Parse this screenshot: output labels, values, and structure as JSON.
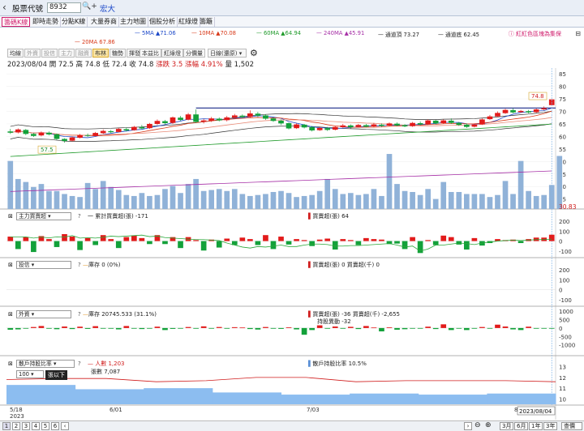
{
  "header": {
    "back_icon": "chevron-left",
    "label": "股票代號",
    "code": "8932",
    "stock_name": "宏大"
  },
  "tabs": [
    "籌碼K線",
    "即時走勢",
    "分點K線",
    "大量券商",
    "主力地圖",
    "個股分析",
    "紅綠燈",
    "籌籬"
  ],
  "ma_legend": [
    {
      "label": "5MA ▲71.06",
      "color": "#1a47c8"
    },
    {
      "label": "10MA ▲70.08",
      "color": "#d83a1a"
    },
    {
      "label": "60MA ▲64.94",
      "color": "#1f9a2a"
    },
    {
      "label": "240MA ▲45.91",
      "color": "#a62fa6"
    },
    {
      "label": "通道頂 73.27",
      "color": "#333333"
    },
    {
      "label": "通道底 62.45",
      "color": "#333333"
    }
  ],
  "ma20_label": "20MA 67.86",
  "promo_text": "紅紅色區塊為集保",
  "toolbar": [
    "均線",
    "外資",
    "投信",
    "主力",
    "融資",
    "布林",
    "糖勢",
    "揮發",
    "本益比",
    "紅綠燈",
    "分價量"
  ],
  "toolbar_selected": "布林",
  "period_select": "日線(還原)",
  "quote": {
    "date": "2023/08/04",
    "open": "開 72.5",
    "high": "高 74.8",
    "low": "低 72.4",
    "close": "收 74.8",
    "change": "漲跌 3.5",
    "pct": "漲幅 4.91%",
    "vol": "量 1,502"
  },
  "price_labels": {
    "high": "74.8",
    "low": "57.5",
    "ma_tag": "30.83"
  },
  "price_axis": [
    "85",
    "80",
    "75",
    "70",
    "65",
    "60",
    "55",
    "50",
    "45",
    "40",
    "35"
  ],
  "panels": [
    {
      "select": "主力買賣超",
      "legend_line": "一 累計買賣超(張) -171",
      "legend_bar": "買賣超(張) 64",
      "axis": [
        "200",
        "100",
        "0",
        "-100"
      ]
    },
    {
      "select": "投信",
      "legend_line": "庫存 0 (0%)",
      "legend_bar": "買賣超(張) 0 買賣超(千) 0",
      "axis": [
        "200",
        "100",
        "0",
        "-100"
      ]
    },
    {
      "select": "外資",
      "legend_line": "庫存 20745.533 (31.1%)",
      "legend_bar": "買賣超(張) -36 買賣超(千) -2,655",
      "legend_extra": "持股異動 -32",
      "axis": [
        "1000",
        "500",
        "0",
        "-500",
        "-1000"
      ]
    },
    {
      "select": "散戶持股比率",
      "legend_line": "人數 1,203",
      "legend_line2": "張數 7,087",
      "legend_bar": "散戶持股比率 10.5%",
      "input_value": "100",
      "input_suffix": "張以下",
      "axis": [
        "13",
        "12",
        "11",
        "10"
      ]
    }
  ],
  "x_axis": {
    "labels": [
      "5/18\n2023",
      "6/01",
      "7/03",
      "8"
    ],
    "current": "2023/08/04"
  },
  "bottom_bar": {
    "pages": [
      "1",
      "2",
      "3",
      "4",
      "5",
      "6"
    ],
    "ranges": [
      "3月",
      "6月",
      "1年",
      "3年",
      "查價"
    ]
  },
  "chart_data": [
    {
      "type": "candlestick",
      "title": "",
      "period": "日線(還原)",
      "candles": [
        [
          62.0,
          61.5,
          63.0,
          61.0
        ],
        [
          61.6,
          62.8,
          63.2,
          61.2
        ],
        [
          62.6,
          61.0,
          63.0,
          60.5
        ],
        [
          61.0,
          60.2,
          61.4,
          59.8
        ],
        [
          60.4,
          61.6,
          62.0,
          60.0
        ],
        [
          61.5,
          60.8,
          62.0,
          60.4
        ],
        [
          60.9,
          59.0,
          61.2,
          58.6
        ],
        [
          59.0,
          58.2,
          59.3,
          57.5
        ],
        [
          58.3,
          59.6,
          60.0,
          58.0
        ],
        [
          59.5,
          60.5,
          61.0,
          59.2
        ],
        [
          60.5,
          60.2,
          61.2,
          59.8
        ],
        [
          60.2,
          61.4,
          61.8,
          60.0
        ],
        [
          61.3,
          62.2,
          62.8,
          61.0
        ],
        [
          62.1,
          61.7,
          62.6,
          61.3
        ],
        [
          61.8,
          63.0,
          63.4,
          61.6
        ],
        [
          62.9,
          62.4,
          63.6,
          62.0
        ],
        [
          62.5,
          63.8,
          64.2,
          62.3
        ],
        [
          63.7,
          63.2,
          64.6,
          62.8
        ],
        [
          63.3,
          65.0,
          65.4,
          63.0
        ],
        [
          65.0,
          66.2,
          66.8,
          64.6
        ],
        [
          66.1,
          65.3,
          66.6,
          64.8
        ],
        [
          65.4,
          67.6,
          68.0,
          65.0
        ],
        [
          67.5,
          66.6,
          68.2,
          66.2
        ],
        [
          66.7,
          68.8,
          69.4,
          66.4
        ],
        [
          68.8,
          65.8,
          70.8,
          65.4
        ],
        [
          65.9,
          66.4,
          67.0,
          65.2
        ],
        [
          66.3,
          67.2,
          67.8,
          65.8
        ],
        [
          67.1,
          66.4,
          67.6,
          66.0
        ],
        [
          66.5,
          67.6,
          68.2,
          66.0
        ],
        [
          67.5,
          68.4,
          69.0,
          67.0
        ],
        [
          68.3,
          67.8,
          68.8,
          67.2
        ],
        [
          67.8,
          69.2,
          70.4,
          67.4
        ],
        [
          69.1,
          68.3,
          69.8,
          67.8
        ],
        [
          68.4,
          67.1,
          68.8,
          66.6
        ],
        [
          67.2,
          66.2,
          67.6,
          65.8
        ],
        [
          66.3,
          65.2,
          66.8,
          64.6
        ],
        [
          65.3,
          63.2,
          65.6,
          62.8
        ],
        [
          63.3,
          64.8,
          65.2,
          63.0
        ],
        [
          64.7,
          63.6,
          65.0,
          63.2
        ],
        [
          63.7,
          62.4,
          64.2,
          62.0
        ],
        [
          62.5,
          63.4,
          63.8,
          62.2
        ],
        [
          63.3,
          62.6,
          63.8,
          62.2
        ],
        [
          62.7,
          63.8,
          64.2,
          62.4
        ],
        [
          63.7,
          64.4,
          65.0,
          63.4
        ],
        [
          64.4,
          63.7,
          64.8,
          63.2
        ],
        [
          63.8,
          64.6,
          65.0,
          63.6
        ],
        [
          64.5,
          63.9,
          65.0,
          63.6
        ],
        [
          64.0,
          64.8,
          65.4,
          63.8
        ],
        [
          64.7,
          64.2,
          65.2,
          63.8
        ],
        [
          64.3,
          65.2,
          65.6,
          64.0
        ],
        [
          65.1,
          64.4,
          65.6,
          64.0
        ],
        [
          64.5,
          64.0,
          64.9,
          63.7
        ],
        [
          64.1,
          65.4,
          65.8,
          63.8
        ],
        [
          65.3,
          64.8,
          66.0,
          64.4
        ],
        [
          64.9,
          66.4,
          66.8,
          64.6
        ],
        [
          66.3,
          65.2,
          66.6,
          64.8
        ],
        [
          65.3,
          66.4,
          66.8,
          65.0
        ],
        [
          66.3,
          65.4,
          67.2,
          65.0
        ],
        [
          65.4,
          64.6,
          65.8,
          64.2
        ],
        [
          64.7,
          63.8,
          65.2,
          63.4
        ],
        [
          63.9,
          64.8,
          65.2,
          63.6
        ],
        [
          64.8,
          66.8,
          67.2,
          64.6
        ],
        [
          66.9,
          68.0,
          68.6,
          66.6
        ],
        [
          68.0,
          69.4,
          70.0,
          67.8
        ],
        [
          69.3,
          70.6,
          71.0,
          69.0
        ],
        [
          70.5,
          69.6,
          71.2,
          69.2
        ],
        [
          69.7,
          70.2,
          70.6,
          69.4
        ],
        [
          70.1,
          69.6,
          70.6,
          69.2
        ],
        [
          69.7,
          70.8,
          71.2,
          69.4
        ],
        [
          70.8,
          71.3,
          72.0,
          70.4
        ],
        [
          72.5,
          74.8,
          74.8,
          72.4
        ]
      ],
      "volume": [
        48,
        30,
        27,
        22,
        25,
        18,
        18,
        15,
        13,
        12,
        26,
        20,
        28,
        22,
        19,
        14,
        13,
        16,
        13,
        14,
        20,
        23,
        16,
        25,
        30,
        18,
        19,
        20,
        18,
        20,
        15,
        13,
        14,
        15,
        17,
        18,
        16,
        12,
        13,
        14,
        18,
        30,
        20,
        15,
        16,
        14,
        15,
        20,
        13,
        55,
        25,
        18,
        17,
        14,
        20,
        10,
        27,
        17,
        17,
        15,
        15,
        15,
        12,
        14,
        28,
        15,
        48,
        18,
        13,
        14,
        24,
        53
      ],
      "volume_label_text": "量",
      "channel_top": 73.27,
      "channel_bottom": 62.45,
      "ma": {
        "5MA": 71.06,
        "10MA": 70.08,
        "20MA": 67.86,
        "60MA": 64.94,
        "240MA": 45.91
      },
      "price_range": [
        31,
        87
      ]
    },
    {
      "type": "bar",
      "name": "主力買賣超",
      "bar_values": [
        45,
        -80,
        40,
        -110,
        50,
        20,
        -60,
        70,
        45,
        -90,
        30,
        -40,
        60,
        20,
        -70,
        40,
        55,
        30,
        -30,
        60,
        -30,
        40,
        -70,
        40,
        10,
        -95,
        15,
        -65,
        25,
        -40,
        35,
        20,
        -40,
        60,
        -80,
        45,
        -35,
        20,
        10,
        -50,
        15,
        25,
        -85,
        20,
        10,
        -40,
        30,
        20,
        15,
        -30,
        -25,
        -80,
        40,
        -120,
        10,
        -40,
        55,
        40,
        -35,
        -85,
        30,
        -45,
        -20,
        20,
        10,
        15,
        -20,
        20,
        35,
        35,
        64
      ],
      "line_values": [
        40,
        40,
        42,
        30,
        40,
        32,
        42,
        40,
        55,
        30,
        35,
        30,
        38,
        50,
        45,
        50,
        55,
        60,
        45,
        50,
        35,
        30,
        25,
        20,
        15,
        15,
        10,
        5,
        -20,
        -40,
        -60,
        -70,
        -55,
        -60,
        -50,
        -40,
        -55,
        -55,
        -40,
        -30,
        -30,
        -35,
        -50,
        -50,
        -45,
        -45,
        -40,
        -35,
        -30,
        -25,
        -40,
        -60,
        -50,
        -100,
        -80,
        -40,
        -40,
        -30,
        -20,
        -25,
        -35,
        -20,
        -10,
        0,
        5,
        10,
        5,
        10,
        15,
        15,
        20
      ],
      "ylim": [
        -150,
        200
      ]
    },
    {
      "type": "bar",
      "name": "投信",
      "bar_values": [],
      "ylim": [
        -150,
        200
      ]
    },
    {
      "type": "bar",
      "name": "外資",
      "bar_values": [
        -100,
        -80,
        -30,
        60,
        120,
        -40,
        -70,
        90,
        -60,
        80,
        -50,
        110,
        -30,
        -40,
        -80,
        120,
        -30,
        -60,
        -20,
        80,
        -120,
        -50,
        -30,
        60,
        -40,
        100,
        -20,
        60,
        -40,
        50,
        30,
        -60,
        -90,
        60,
        -40,
        -50,
        40,
        -80,
        -400,
        -120,
        160,
        -40,
        90,
        -40,
        70,
        -60,
        120,
        30,
        -200,
        40,
        -100,
        -70,
        -30,
        -20,
        80,
        -60,
        220,
        -120,
        -20,
        -120,
        -40,
        60,
        -30,
        200,
        90,
        -80,
        -120,
        80,
        -40,
        -20,
        -36
      ],
      "ylim": [
        -1500,
        1200
      ]
    },
    {
      "type": "area",
      "name": "散戶持股比率",
      "step_values": [
        11.3,
        10.9,
        11.0,
        10.6,
        10.4,
        10.5,
        10.4,
        10.5
      ],
      "line_values": [
        11.8,
        11.9,
        11.9,
        11.6,
        11.7,
        12.0,
        12.0,
        11.6,
        11.7,
        11.7,
        11.7,
        11.6
      ],
      "ylim": [
        9.5,
        13.5
      ]
    }
  ]
}
